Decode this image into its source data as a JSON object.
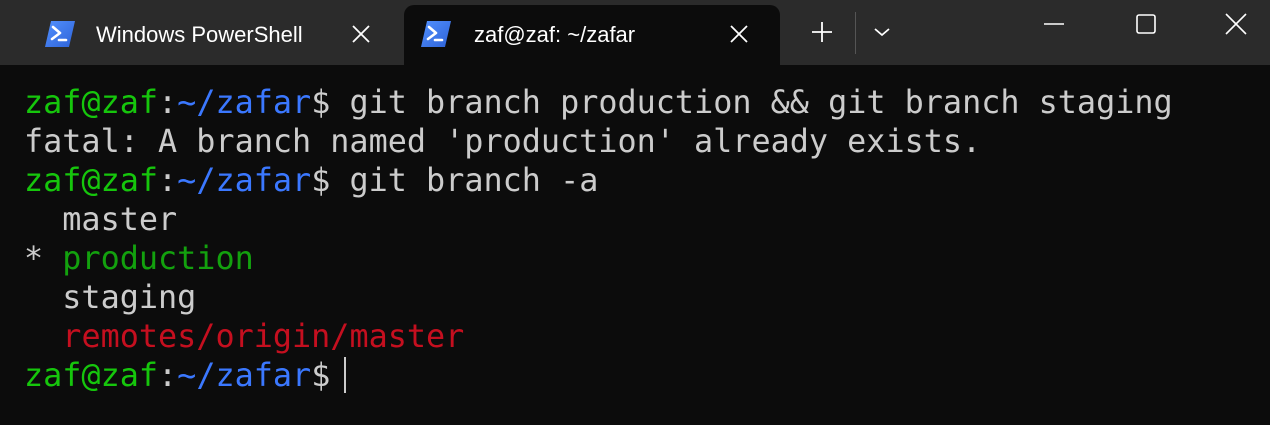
{
  "tabs": [
    {
      "label": "Windows PowerShell",
      "icon": "powershell-icon",
      "active": false
    },
    {
      "label": "zaf@zaf: ~/zafar",
      "icon": "powershell-icon",
      "active": true
    }
  ],
  "toolbar": {
    "new_tab_icon": "plus-icon",
    "dropdown_icon": "chevron-down-icon"
  },
  "window_controls": [
    "minimize-icon",
    "maximize-icon",
    "close-icon"
  ],
  "terminal": {
    "prompt": {
      "user_host": "zaf@zaf",
      "separator": ":",
      "path": "~/zafar",
      "symbol": "$"
    },
    "lines": [
      {
        "type": "prompt",
        "command": " git branch production && git branch staging"
      },
      {
        "type": "output",
        "text": "fatal: A branch named 'production' already exists."
      },
      {
        "type": "prompt",
        "command": " git branch -a"
      },
      {
        "type": "output",
        "text": "  master"
      },
      {
        "type": "output_current",
        "marker": "* ",
        "text": "production"
      },
      {
        "type": "output",
        "text": "  staging"
      },
      {
        "type": "output_remote",
        "indent": "  ",
        "text": "remotes/origin/master"
      },
      {
        "type": "prompt",
        "command": " "
      }
    ]
  },
  "colors": {
    "prompt_user": "#16c60c",
    "prompt_path": "#3b78ff",
    "current_branch": "#13a10e",
    "remote_branch": "#c50f1f",
    "default_text": "#cccccc",
    "terminal_bg": "#0c0c0c",
    "titlebar_bg": "#2b2b2b"
  }
}
